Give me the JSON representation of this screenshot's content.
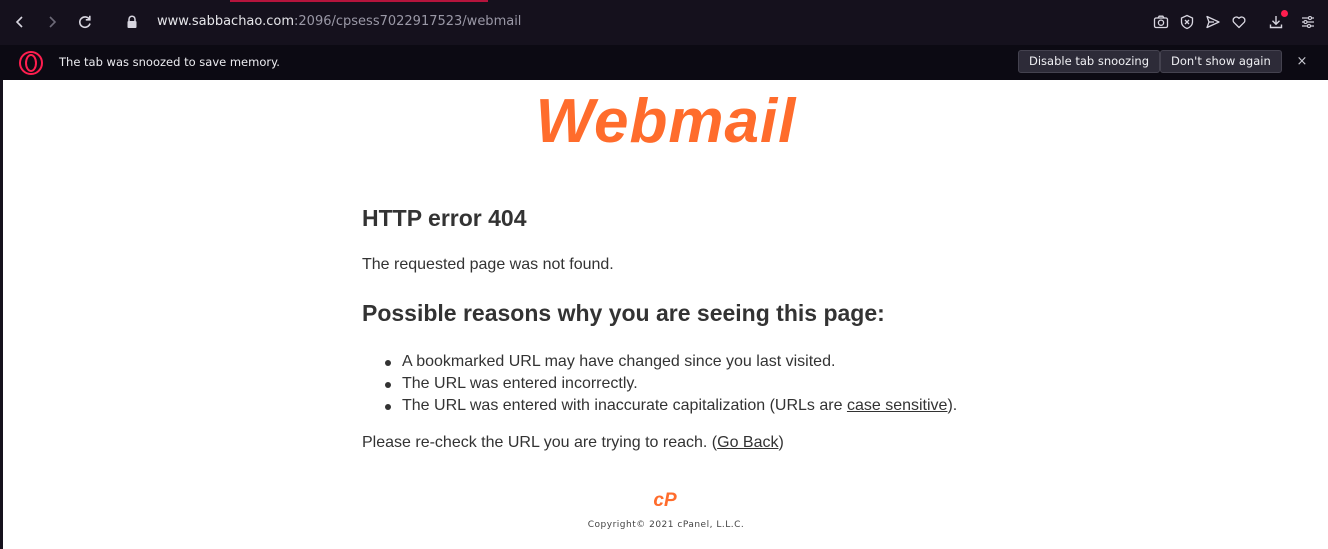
{
  "browser": {
    "url_host": "www.sabbachao.com",
    "url_path": ":2096/cpsess7022917523/webmail",
    "nav_icons": [
      "back-icon",
      "forward-icon",
      "reload-icon",
      "lock-icon"
    ],
    "toolbar_icons": [
      "camera-icon",
      "shield-icon",
      "send-icon",
      "heart-icon",
      "download-icon",
      "menu-icon"
    ],
    "accent_color": "#b5143c"
  },
  "snooze_bar": {
    "icon": "opera-logo-icon",
    "message": "The tab was snoozed to save memory.",
    "disable_label": "Disable tab snoozing",
    "dont_show_label": "Don't show again",
    "close_label": "×"
  },
  "page": {
    "logo_text": "Webmail",
    "logo_color": "#ff6c2c",
    "error_title": "HTTP error 404",
    "error_message": "The requested page was not found.",
    "reasons_title": "Possible reasons why you are seeing this page:",
    "reasons": [
      "A bookmarked URL may have changed since you last visited.",
      "The URL was entered incorrectly."
    ],
    "reason3_prefix": "The URL was entered with inaccurate capitalization (URLs are ",
    "reason3_link": "case sensitive",
    "reason3_suffix": ").",
    "recheck_prefix": "Please re-check the URL you are trying to reach. (",
    "go_back_link": "Go Back",
    "recheck_suffix": ")",
    "footer_logo": "cP",
    "copyright": "Copyright© 2021 cPanel, L.L.C."
  }
}
